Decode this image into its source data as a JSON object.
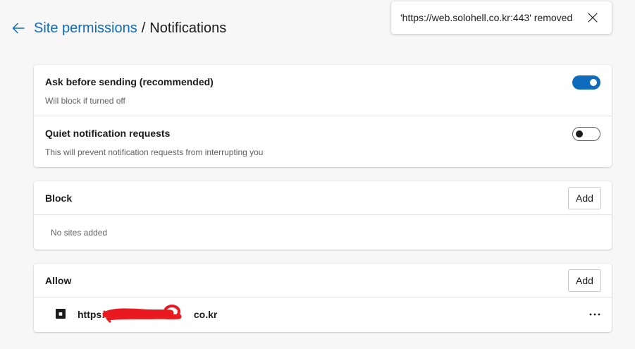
{
  "header": {
    "back_icon": "arrow-left-icon",
    "crumb_parent": "Site permissions",
    "crumb_separator": "/",
    "crumb_current": "Notifications"
  },
  "toast": {
    "message": "'https://web.solohell.co.kr:443' removed",
    "close_icon": "close-icon"
  },
  "settings": {
    "ask_before_sending": {
      "title": "Ask before sending (recommended)",
      "subtitle": "Will block if turned off",
      "enabled": true
    },
    "quiet_requests": {
      "title": "Quiet notification requests",
      "subtitle": "This will prevent notification requests from interrupting you",
      "enabled": false
    }
  },
  "block": {
    "title": "Block",
    "add_label": "Add",
    "empty_text": "No sites added"
  },
  "allow": {
    "title": "Allow",
    "add_label": "Add",
    "sites": [
      {
        "url_prefix": "https:",
        "url_suffix": "co.kr",
        "more_icon": "more-horizontal-icon"
      }
    ]
  },
  "colors": {
    "accent": "#0f6cbd",
    "background": "#f7f7f7",
    "card": "#ffffff",
    "redaction": "#e8191f"
  }
}
